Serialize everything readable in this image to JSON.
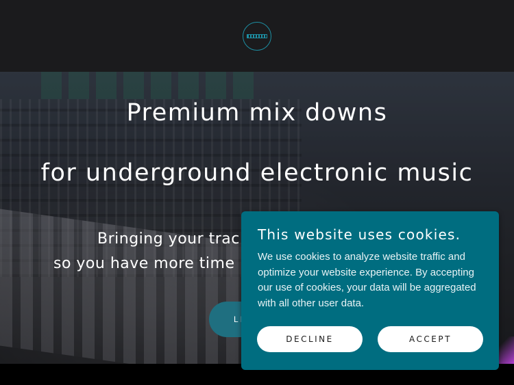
{
  "header": {
    "logo_icon": "equalizer-logo-icon"
  },
  "hero": {
    "title_line1": "Premium mix downs",
    "title_line2": "for underground electronic music",
    "subtitle_line1": "Bringing your trac",
    "subtitle_line2": "so you have more time",
    "cta_label": "LI"
  },
  "cookie_banner": {
    "title": "This website uses cookies.",
    "body": "We use cookies to analyze website traffic and optimize your website experience. By accepting our use of cookies, your data will be aggregated with all other user data.",
    "decline_label": "DECLINE",
    "accept_label": "ACCEPT",
    "background_color": "#006d80"
  },
  "colors": {
    "header_bg": "#1b1b1d",
    "accent": "#1d8fa3",
    "cta_bg": "#1f6f80"
  }
}
